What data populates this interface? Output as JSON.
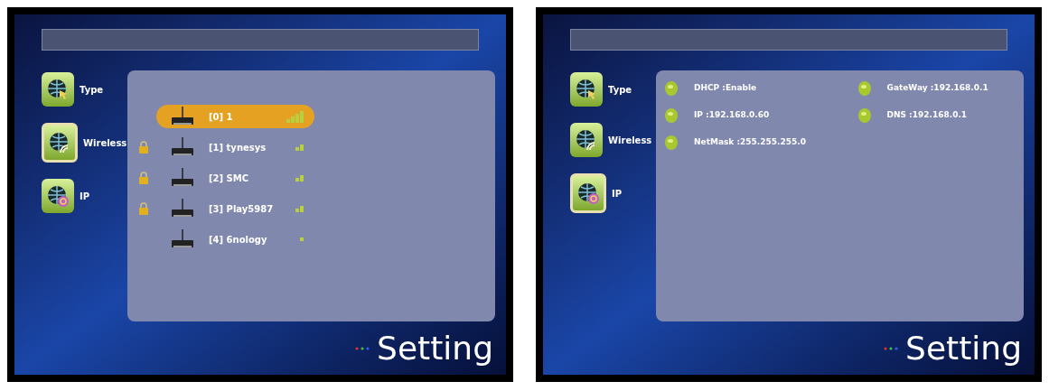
{
  "screens": [
    {
      "menu": [
        {
          "label": "Type",
          "selected": false
        },
        {
          "label": "Wireless",
          "selected": true
        },
        {
          "label": "IP",
          "selected": false
        }
      ],
      "content": {
        "kind": "networks",
        "networks": [
          {
            "name": "[0] 1",
            "locked": false,
            "selected": true,
            "kind": "strong"
          },
          {
            "name": "[1] tynesys",
            "locked": true,
            "selected": false,
            "kind": "medium"
          },
          {
            "name": "[2] SMC",
            "locked": true,
            "selected": false,
            "kind": "medium"
          },
          {
            "name": "[3] Play5987",
            "locked": true,
            "selected": false,
            "kind": "medium"
          },
          {
            "name": "[4] 6nology",
            "locked": false,
            "selected": false,
            "kind": "weak"
          }
        ]
      },
      "title": "Setting"
    },
    {
      "menu": [
        {
          "label": "Type",
          "selected": false
        },
        {
          "label": "Wireless",
          "selected": false
        },
        {
          "label": "IP",
          "selected": true
        }
      ],
      "content": {
        "kind": "info",
        "items": [
          {
            "text": "DHCP :Enable"
          },
          {
            "text": "GateWay :192.168.0.1"
          },
          {
            "text": "IP :192.168.0.60"
          },
          {
            "text": "DNS :192.168.0.1"
          },
          {
            "text": "NetMask :255.255.255.0"
          }
        ]
      },
      "title": "Setting"
    }
  ]
}
